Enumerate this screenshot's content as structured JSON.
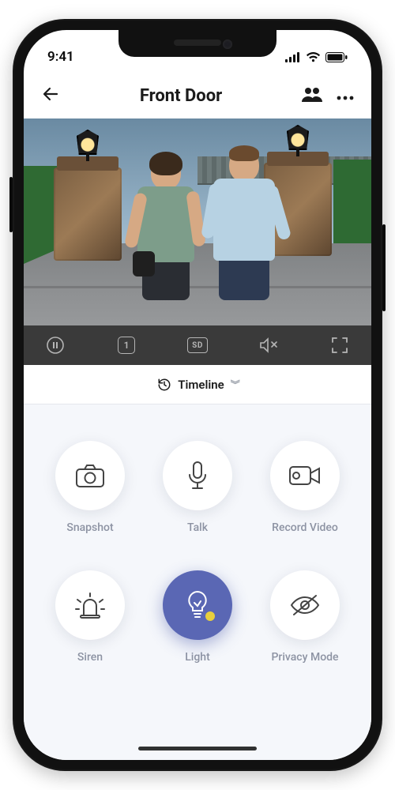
{
  "status": {
    "time": "9:41"
  },
  "header": {
    "title": "Front Door",
    "icons": {
      "back": "back-arrow-icon",
      "share": "people-icon",
      "more": "more-dots-icon"
    }
  },
  "video_toolbar": {
    "stream_count": "1",
    "quality": "SD",
    "icons": {
      "pause": "pause-icon",
      "mute": "speaker-muted-icon",
      "fullscreen": "fullscreen-icon"
    }
  },
  "timeline": {
    "label": "Timeline"
  },
  "actions": [
    {
      "id": "snapshot",
      "label": "Snapshot",
      "icon": "camera-icon",
      "active": false
    },
    {
      "id": "talk",
      "label": "Talk",
      "icon": "microphone-icon",
      "active": false
    },
    {
      "id": "record",
      "label": "Record Video",
      "icon": "video-camera-icon",
      "active": false
    },
    {
      "id": "siren",
      "label": "Siren",
      "icon": "siren-icon",
      "active": false
    },
    {
      "id": "light",
      "label": "Light",
      "icon": "lightbulb-icon",
      "active": true
    },
    {
      "id": "privacy",
      "label": "Privacy Mode",
      "icon": "eye-off-icon",
      "active": false
    }
  ],
  "colors": {
    "accent": "#5a67b4",
    "panel": "#f5f7fb",
    "toolbar": "#3a3a3a",
    "indicator_dot": "#e8cf3d"
  }
}
